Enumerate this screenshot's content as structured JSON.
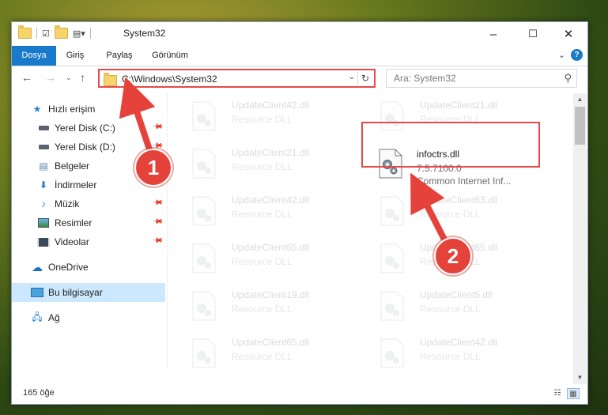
{
  "window": {
    "title": "System32",
    "controls": {
      "minimize": "–",
      "maximize": "☐",
      "close": "✕"
    }
  },
  "ribbon": {
    "tabs": [
      {
        "label": "Dosya",
        "active": true
      },
      {
        "label": "Giriş"
      },
      {
        "label": "Paylaş"
      },
      {
        "label": "Görünüm"
      }
    ],
    "help_label": "?"
  },
  "nav": {
    "address": "C:\\Windows\\System32",
    "search_placeholder": "Ara: System32"
  },
  "sidebar": {
    "items": [
      {
        "label": "Hızlı erişim",
        "icon": "star-icon",
        "pinned": false
      },
      {
        "label": "Yerel Disk (C:)",
        "icon": "drive-icon",
        "pinned": true
      },
      {
        "label": "Yerel Disk (D:)",
        "icon": "drive-icon",
        "pinned": true
      },
      {
        "label": "Belgeler",
        "icon": "document-icon",
        "pinned": true
      },
      {
        "label": "İndirmeler",
        "icon": "download-icon",
        "pinned": true
      },
      {
        "label": "Müzik",
        "icon": "music-icon",
        "pinned": true
      },
      {
        "label": "Resimler",
        "icon": "picture-icon",
        "pinned": true
      },
      {
        "label": "Videolar",
        "icon": "video-icon",
        "pinned": true
      },
      {
        "label": "OneDrive",
        "icon": "cloud-icon",
        "pinned": false
      },
      {
        "label": "Bu bilgisayar",
        "icon": "computer-icon",
        "pinned": false,
        "selected": true
      },
      {
        "label": "Ağ",
        "icon": "network-icon",
        "pinned": false
      }
    ]
  },
  "files": {
    "left_column": [
      {
        "name": "UpdateClient42.dll",
        "type": "Resource DLL"
      },
      {
        "name": "UpdateClient21.dll",
        "type": "Resource DLL"
      },
      {
        "name": "UpdateClient42.dll",
        "type": "Resource DLL"
      },
      {
        "name": "UpdateClient65.dll",
        "type": "Resource DLL"
      },
      {
        "name": "UpdateClient19.dll",
        "type": "Resource DLL"
      },
      {
        "name": "UpdateClient65.dll",
        "type": "Resource DLL"
      }
    ],
    "right_column": [
      {
        "name": "UpdateClient21.dll",
        "type": "Resource DLL"
      },
      {
        "name": "infoctrs.dll",
        "version": "7.5.7100.0",
        "type": "Common Internet Inf...",
        "highlighted": true
      },
      {
        "name": "UpdateClient63.dll",
        "type": "Resource DLL"
      },
      {
        "name": "UpdateClient65.dll",
        "type": "Resource DLL"
      },
      {
        "name": "UpdateClient5.dll",
        "type": "Resource DLL"
      },
      {
        "name": "UpdateClient42.dll",
        "type": "Resource DLL"
      }
    ]
  },
  "status": {
    "item_count": "165 öğe"
  },
  "annotations": [
    {
      "number": "1",
      "color": "#e4423b"
    },
    {
      "number": "2",
      "color": "#e4423b"
    }
  ],
  "colors": {
    "accent": "#1979ca",
    "highlight": "#e54a4a",
    "selection": "#cce8ff"
  }
}
